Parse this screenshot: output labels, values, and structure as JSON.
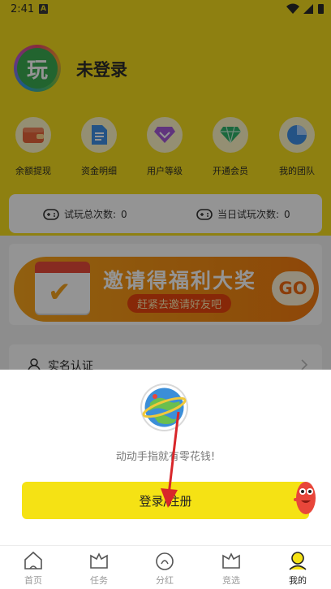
{
  "status_bar": {
    "time": "2:41",
    "notification_letter": "A"
  },
  "profile": {
    "avatar_text": "玩",
    "username": "未登录"
  },
  "menu": [
    {
      "label": "余额提现",
      "icon": "wallet-icon"
    },
    {
      "label": "资金明细",
      "icon": "document-icon"
    },
    {
      "label": "用户等级",
      "icon": "diamond-icon"
    },
    {
      "label": "开通会员",
      "icon": "gem-icon"
    },
    {
      "label": "我的团队",
      "icon": "pie-chart-icon"
    }
  ],
  "stats": {
    "total_label": "试玩总次数: ",
    "total_value": "0",
    "today_label": "当日试玩次数: ",
    "today_value": "0"
  },
  "banner": {
    "title": "邀请得福利大奖",
    "subtitle": "赶紧去邀请好友吧",
    "go": "GO"
  },
  "verify": {
    "label": "实名认证"
  },
  "login_sheet": {
    "slogan": "动动手指就有零花钱!",
    "button": "登录/注册"
  },
  "tabs": [
    {
      "label": "首页",
      "icon": "home-icon",
      "active": false
    },
    {
      "label": "任务",
      "icon": "task-icon",
      "active": false
    },
    {
      "label": "分红",
      "icon": "dividend-icon",
      "active": false
    },
    {
      "label": "竞选",
      "icon": "election-icon",
      "active": false
    },
    {
      "label": "我的",
      "icon": "profile-icon",
      "active": true
    }
  ],
  "colors": {
    "brand_yellow": "#f4dd1e",
    "button_yellow": "#f5e214",
    "banner_orange": "#f38a12"
  }
}
